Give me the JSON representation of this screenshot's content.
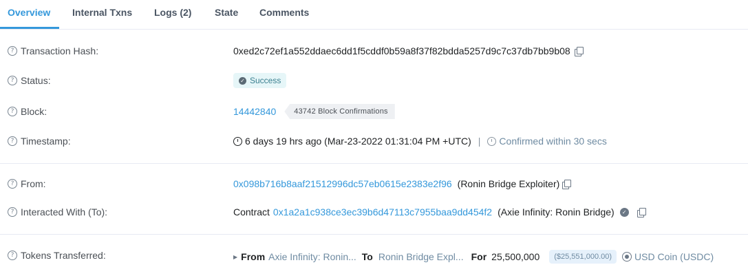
{
  "tabs": [
    {
      "label": "Overview",
      "active": true
    },
    {
      "label": "Internal Txns",
      "active": false
    },
    {
      "label": "Logs (2)",
      "active": false
    },
    {
      "label": "State",
      "active": false
    },
    {
      "label": "Comments",
      "active": false
    }
  ],
  "rows": {
    "tx_hash": {
      "label": "Transaction Hash:",
      "value": "0xed2c72ef1a552ddaec6dd1f5cddf0b59a8f37f82bdda5257d9c7c37db7bb9b08"
    },
    "status": {
      "label": "Status:",
      "value": "Success"
    },
    "block": {
      "label": "Block:",
      "number": "14442840",
      "confirmations": "43742 Block Confirmations"
    },
    "timestamp": {
      "label": "Timestamp:",
      "value": "6 days 19 hrs ago (Mar-23-2022 01:31:04 PM +UTC)",
      "separator": "|",
      "confirmed": "Confirmed within 30 secs"
    },
    "from": {
      "label": "From:",
      "address": "0x098b716b8aaf21512996dc57eb0615e2383e2f96",
      "name": "(Ronin Bridge Exploiter)"
    },
    "to": {
      "label": "Interacted With (To):",
      "prefix": "Contract",
      "address": "0x1a2a1c938ce3ec39b6d47113c7955baa9dd454f2",
      "name": "(Axie Infinity: Ronin Bridge)"
    },
    "tokens": {
      "label": "Tokens Transferred:",
      "from_label": "From",
      "from_value": "Axie Infinity: Ronin...",
      "to_label": "To",
      "to_value": "Ronin Bridge Expl...",
      "for_label": "For",
      "amount": "25,500,000",
      "usd": "($25,551,000.00)",
      "token": "USD Coin (USDC)"
    }
  },
  "icons": {
    "help": "question-circle-icon",
    "copy": "copy-icon",
    "check": "check-circle-icon",
    "clock": "clock-icon",
    "timer": "timer-icon",
    "verified": "verified-check-icon",
    "coin": "usdc-coin-icon",
    "caret": "caret-right-icon"
  },
  "colors": {
    "link": "#3498db",
    "success_bg": "#e6f6f8",
    "badge_bg": "#eef0f3"
  }
}
